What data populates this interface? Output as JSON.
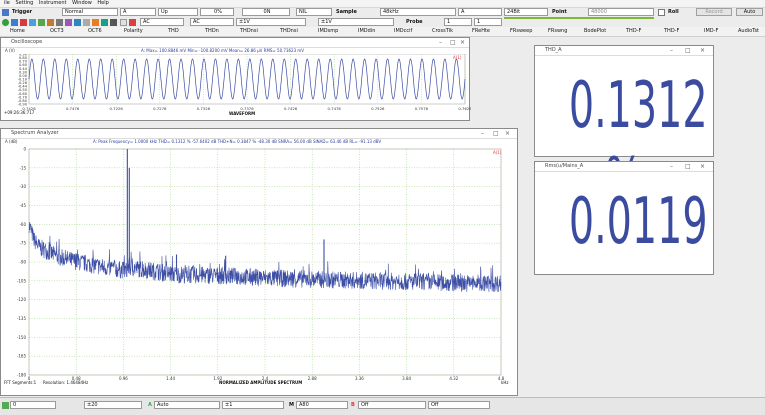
{
  "menu": [
    "ile",
    "Setting",
    "Instrument",
    "Window",
    "Help"
  ],
  "toolbar1": {
    "trigger_label": "Trigger",
    "mode": "Normal",
    "channel": "A",
    "slope": "Up",
    "level": "0%",
    "position": "0N",
    "coupling": "NIL",
    "sample_label": "Sample",
    "sample_rate": "48kHz",
    "sample_channel": "A",
    "bits": "24Bit",
    "point_label": "Point",
    "points": "48000",
    "roll_label": "Roll",
    "record_label": "Record",
    "auto_label": "Auto"
  },
  "toolbar2": {
    "coupling_a": "AC",
    "coupling_b": "AC",
    "range_a": "±1V",
    "range_b": "±1V",
    "probe_label": "Probe",
    "probe_a": "1",
    "probe_b": "1"
  },
  "nav": [
    "Home",
    "OCT3",
    "OCT6",
    "Polarity",
    "THD",
    "THDn",
    "THDnsi",
    "THDnsi",
    "IMDsmp",
    "IMDdin",
    "IMDccif",
    "CrossTlk",
    "FReHte",
    "FRsweep",
    "FRswng",
    "BodePlot",
    "THD-F",
    "THD-F",
    "IMD-F",
    "AudioTst"
  ],
  "oscilloscope": {
    "title": "Oscilloscope",
    "unit": "A (V)",
    "stats": "A: Max= 100.8846 mV Min= -100.8200 mV Mean= 26.86 µV RMS= 50.73623 mV",
    "timestamp": "+09:26:36:717",
    "channel_tag": "A(1)",
    "y_ticks": [
      "0.90",
      "0.80",
      "0.70",
      "0.60",
      "0.44",
      "0.30",
      "0.00",
      "-0.10",
      "-0.26",
      "-0.44",
      "-0.50",
      "-0.60",
      "-0.70",
      "-0.80",
      "-0.90"
    ],
    "x_ticks": [
      "0.7426",
      "0.7476",
      "0.7226",
      "0.7276",
      "0.7326",
      "0.7376",
      "0.7426",
      "0.7476",
      "0.7526",
      "0.7576",
      "0.7626"
    ],
    "xlabel": "WAVEFORM"
  },
  "spectrum": {
    "title": "Spectrum Analyzer",
    "unit": "A (dB)",
    "stats": "A: Peak Frequency= 1.0000 kHz THD= 0.1312 % -57.6402 dB THD+N= 0.3847 % -48.30 dB SNRA= 56.00 dB SINAD= 63.46 dB RL= -91.13 dBV",
    "channel_tag": "A(1)",
    "y_ticks": [
      "0",
      "-15",
      "-30",
      "-45",
      "-60",
      "-75",
      "-90",
      "-105",
      "-120",
      "-135",
      "-150",
      "-165",
      "-180"
    ],
    "x_ticks": [
      "0",
      "0.48",
      "0.96",
      "1.44",
      "1.92",
      "2.4",
      "2.88",
      "3.36",
      "3.84",
      "4.32",
      "4.8"
    ],
    "x_unit": "kHz",
    "xlabel": "NORMALIZED AMPLITUDE SPECTRUM",
    "footer_left": "FFT Segments:1",
    "footer_res": "Resolution: 1.46484Hz"
  },
  "thd_window": {
    "title": "THD_A",
    "value": "0.1312 %"
  },
  "rms_window": {
    "title": "Rms(u/Mains_A",
    "value": "0.0119"
  },
  "chart_data": {
    "type": "line",
    "title": "NORMALIZED AMPLITUDE SPECTRUM",
    "xlabel": "kHz",
    "ylabel": "A (dB)",
    "xlim": [
      0,
      4.8
    ],
    "ylim": [
      -180,
      0
    ],
    "series": [
      {
        "x": [
          0,
          0.05,
          0.1,
          0.2,
          0.3,
          0.5,
          0.75,
          1.0,
          1.25,
          1.5,
          2.0,
          2.5,
          3.0,
          3.5,
          4.0,
          4.5,
          4.8
        ],
        "values": [
          -60,
          -72,
          -78,
          -82,
          -86,
          -90,
          -94,
          0,
          -97,
          -100,
          -101,
          -103,
          -104,
          -105,
          -106,
          -107,
          -107
        ]
      }
    ],
    "peaks": [
      {
        "x": 1.0,
        "y": 0
      },
      {
        "x": 1.02,
        "y": -15
      },
      {
        "x": 1.5,
        "y": -84
      },
      {
        "x": 2.0,
        "y": -85
      },
      {
        "x": 3.0,
        "y": -72
      }
    ],
    "grid": true
  },
  "status": {
    "field1": "0",
    "field2": "±20",
    "field3_label": "A",
    "field3": "Auto",
    "field4": "±1",
    "field5_label": "M",
    "field5": "A80",
    "field6_label": "B",
    "field6": "Off",
    "field7": "Off"
  }
}
